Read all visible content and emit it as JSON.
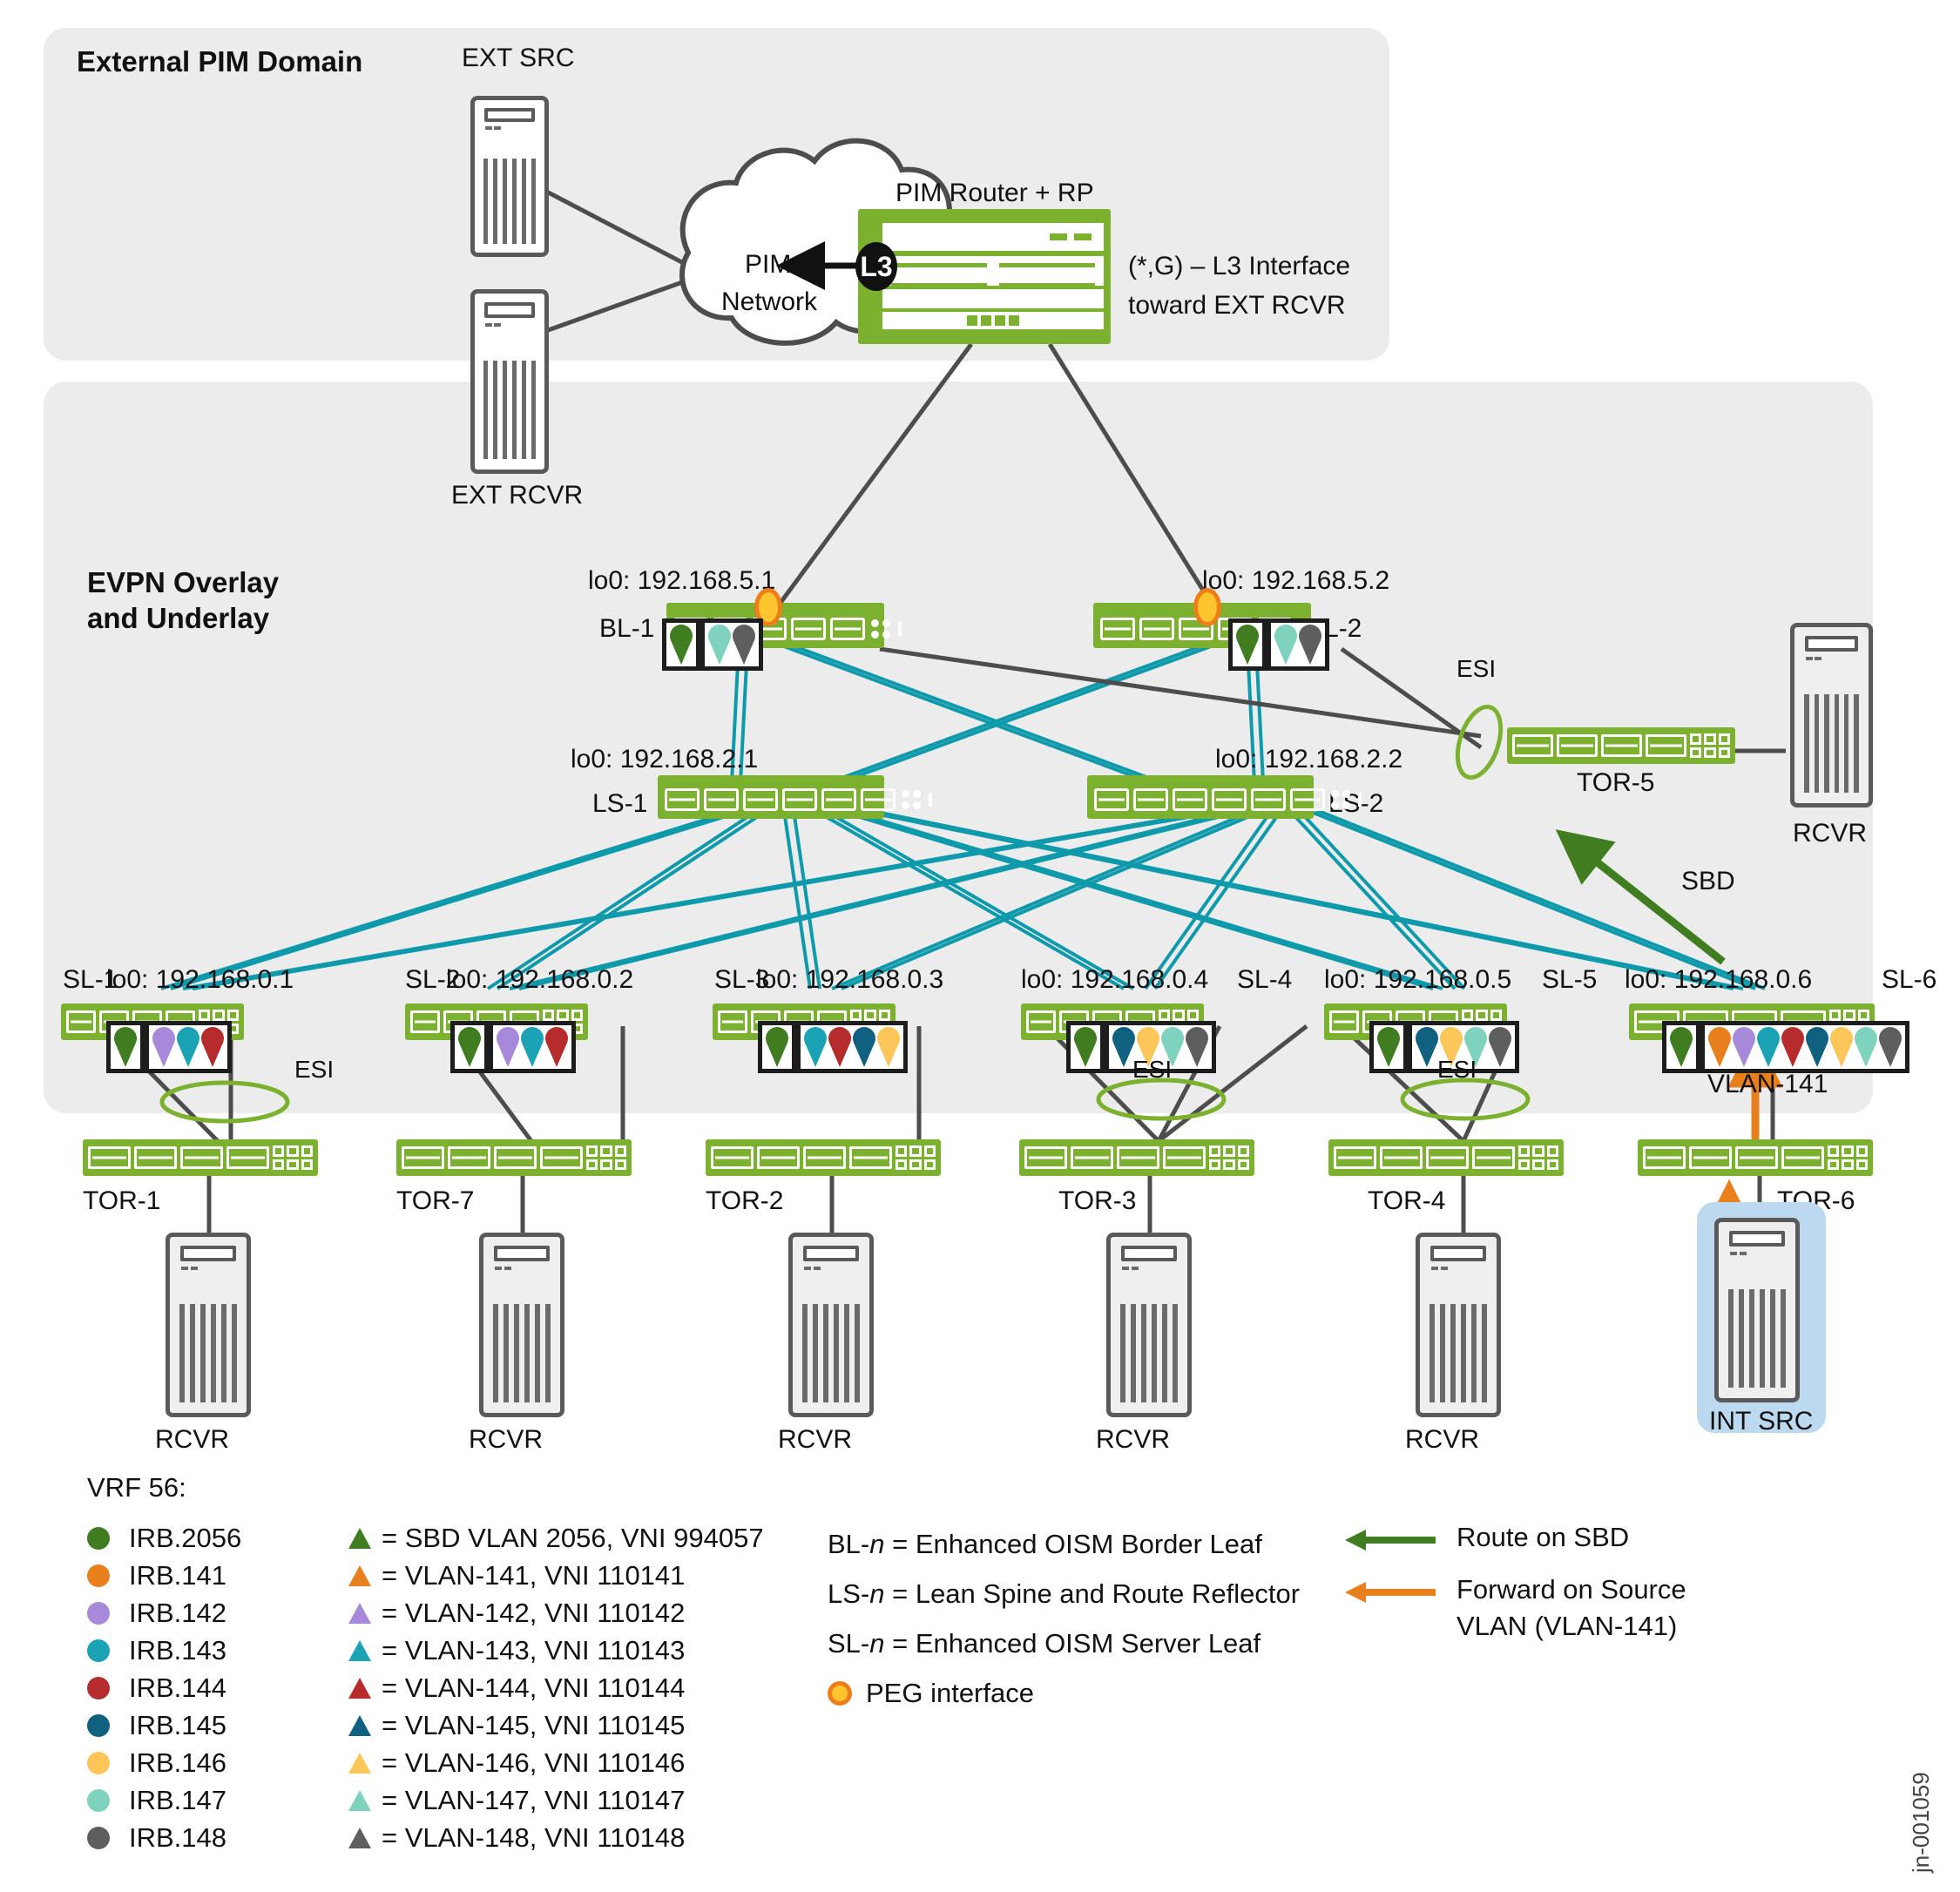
{
  "panels": {
    "external": {
      "title": "External PIM Domain"
    },
    "evpn": {
      "title_line1": "EVPN Overlay",
      "title_line2": "and Underlay"
    }
  },
  "external_domain": {
    "ext_src_label": "EXT SRC",
    "ext_rcvr_label": "EXT RCVR",
    "cloud_line1": "PIM",
    "cloud_line2": "Network",
    "pim_router_label": "PIM Router + RP",
    "l3_badge": "L3",
    "annotation_line1": "(*,G) – L3 Interface",
    "annotation_line2": "toward EXT RCVR"
  },
  "border_leaves": [
    {
      "name": "BL-1",
      "loopback": "lo0: 192.168.5.1",
      "peg": true,
      "sbd_markers": [
        "irb2056"
      ],
      "vlan_markers": [
        "vlan147",
        "vlan148"
      ]
    },
    {
      "name": "BL-2",
      "loopback": "lo0: 192.168.5.2",
      "peg": true,
      "sbd_markers": [
        "irb2056"
      ],
      "vlan_markers": [
        "vlan147",
        "vlan148"
      ]
    }
  ],
  "spines": [
    {
      "name": "LS-1",
      "loopback": "lo0: 192.168.2.1"
    },
    {
      "name": "LS-2",
      "loopback": "lo0: 192.168.2.2"
    }
  ],
  "server_leaves": [
    {
      "name": "SL-1",
      "loopback": "lo0: 192.168.0.1",
      "sbd_markers": [
        "irb2056"
      ],
      "vlan_markers": [
        "vlan142",
        "vlan143",
        "vlan144"
      ]
    },
    {
      "name": "SL-2",
      "loopback": "lo0: 192.168.0.2",
      "sbd_markers": [
        "irb2056"
      ],
      "vlan_markers": [
        "vlan142",
        "vlan143",
        "vlan144"
      ]
    },
    {
      "name": "SL-3",
      "loopback": "lo0: 192.168.0.3",
      "sbd_markers": [
        "irb2056"
      ],
      "vlan_markers": [
        "vlan143",
        "vlan144",
        "vlan145",
        "vlan146"
      ]
    },
    {
      "name": "SL-4",
      "loopback": "lo0: 192.168.0.4",
      "sbd_markers": [
        "irb2056"
      ],
      "vlan_markers": [
        "vlan145",
        "vlan146",
        "vlan147",
        "vlan148"
      ]
    },
    {
      "name": "SL-5",
      "loopback": "lo0: 192.168.0.5",
      "sbd_markers": [
        "irb2056"
      ],
      "vlan_markers": [
        "vlan145",
        "vlan146",
        "vlan147",
        "vlan148"
      ]
    },
    {
      "name": "SL-6",
      "loopback": "lo0: 192.168.0.6",
      "sbd_markers": [
        "irb2056"
      ],
      "vlan_markers": [
        "vlan141",
        "vlan142",
        "vlan143",
        "vlan144",
        "vlan145",
        "vlan146",
        "vlan147",
        "vlan148"
      ]
    }
  ],
  "tors": [
    {
      "name": "TOR-1"
    },
    {
      "name": "TOR-7"
    },
    {
      "name": "TOR-2"
    },
    {
      "name": "TOR-3"
    },
    {
      "name": "TOR-4"
    },
    {
      "name": "TOR-6"
    },
    {
      "name": "TOR-5"
    }
  ],
  "hosts": [
    {
      "name": "RCVR"
    },
    {
      "name": "RCVR"
    },
    {
      "name": "RCVR"
    },
    {
      "name": "RCVR"
    },
    {
      "name": "RCVR"
    },
    {
      "name": "INT SRC"
    },
    {
      "name": "RCVR"
    }
  ],
  "esi_labels": [
    "ESI",
    "ESI",
    "ESI",
    "ESI"
  ],
  "flow_labels": {
    "sbd": "SBD",
    "vlan141": "VLAN-141"
  },
  "legend": {
    "vrf_title": "VRF 56:",
    "irb_items": [
      {
        "label": "IRB.2056",
        "color": "#3f7d20"
      },
      {
        "label": "IRB.141",
        "color": "#e8801e"
      },
      {
        "label": "IRB.142",
        "color": "#a689d8"
      },
      {
        "label": "IRB.143",
        "color": "#1ba3b5"
      },
      {
        "label": "IRB.144",
        "color": "#b62b2b"
      },
      {
        "label": "IRB.145",
        "color": "#10607f"
      },
      {
        "label": "IRB.146",
        "color": "#fdc659"
      },
      {
        "label": "IRB.147",
        "color": "#7fd2bd"
      },
      {
        "label": "IRB.148",
        "color": "#5e5e5e"
      }
    ],
    "vlan_items": [
      {
        "label": "= SBD VLAN 2056, VNI 994057",
        "color": "#3f7d20"
      },
      {
        "label": "= VLAN-141, VNI 110141",
        "color": "#e8801e"
      },
      {
        "label": "= VLAN-142, VNI 110142",
        "color": "#a689d8"
      },
      {
        "label": "= VLAN-143, VNI 110143",
        "color": "#1ba3b5"
      },
      {
        "label": "= VLAN-144, VNI 110144",
        "color": "#b62b2b"
      },
      {
        "label": "= VLAN-145, VNI 110145",
        "color": "#10607f"
      },
      {
        "label": "= VLAN-146, VNI 110146",
        "color": "#fdc659"
      },
      {
        "label": "= VLAN-147, VNI 110147",
        "color": "#7fd2bd"
      },
      {
        "label": "= VLAN-148, VNI 110148",
        "color": "#5e5e5e"
      }
    ],
    "role_items": [
      {
        "prefix": "BL-",
        "ital": "n",
        "rest": " = Enhanced OISM Border Leaf"
      },
      {
        "prefix": "LS-",
        "ital": "n",
        "rest": " = Lean Spine and Route Reflector"
      },
      {
        "prefix": "SL-",
        "ital": "n",
        "rest": " = Enhanced OISM Server Leaf"
      }
    ],
    "peg_label": "PEG interface",
    "arrow_items": [
      {
        "label": "Route on SBD",
        "color": "#3f7d20"
      },
      {
        "label": "Forward on Source\nVLAN (VLAN-141)",
        "color": "#e8801e"
      }
    ]
  },
  "colors": {
    "device_green": "#7cb130",
    "underlay_link": "#0f9aab",
    "overlay_link": "#4d4d4d",
    "esi_green": "#7cb130",
    "peg_fill": "#fdc62e",
    "peg_stroke": "#ef7d19",
    "panel_bg": "#ececec",
    "int_src_bg": "#bcd9f0",
    "sbd_arrow": "#3f7d20",
    "vlan141_arrow": "#e8801e"
  },
  "figure_id": "jn-001059"
}
